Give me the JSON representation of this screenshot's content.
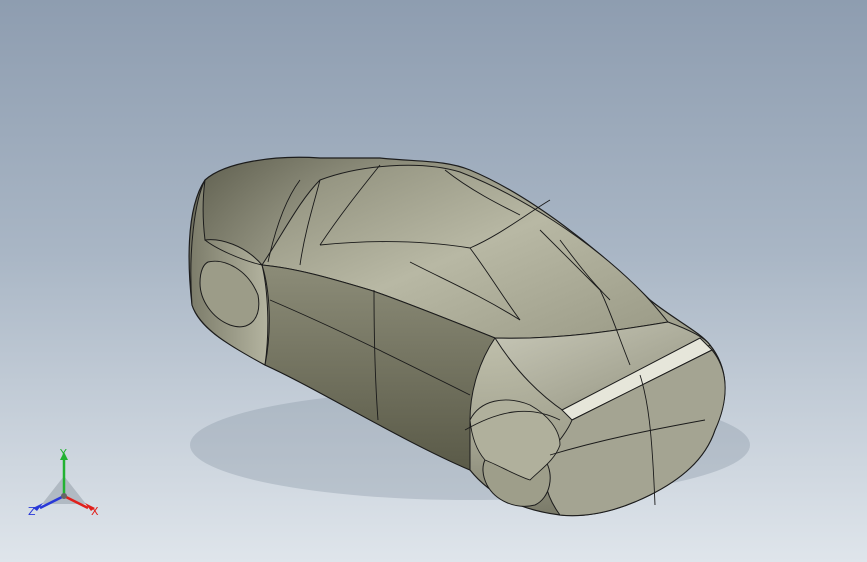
{
  "viewport": {
    "background_top": "#8e9db0",
    "background_bottom": "#dfe5eb",
    "model": "car-body-surface"
  },
  "triad": {
    "x_label": "X",
    "y_label": "Y",
    "z_label": "Z",
    "x_color": "#e0201c",
    "y_color": "#22b232",
    "z_color": "#2838d8"
  }
}
